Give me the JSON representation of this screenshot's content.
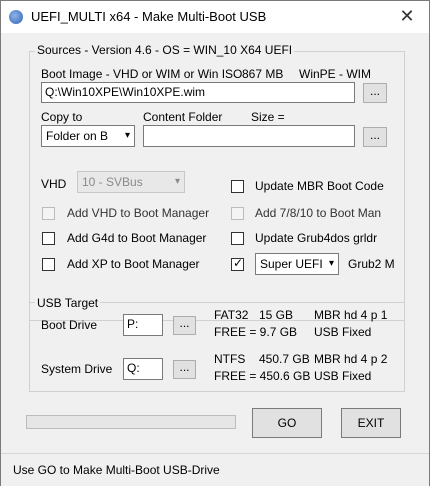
{
  "window": {
    "title": "UEFI_MULTI x64 - Make Multi-Boot USB",
    "close_glyph": "✕"
  },
  "sources": {
    "legend": "Sources  - Version 4.6  -  OS = WIN_10 X64  UEFI",
    "boot_image_label": "Boot Image - VHD or WIM or Win ISO",
    "boot_image_size": "867 MB",
    "boot_image_type": "WinPE - WIM",
    "boot_image_path": "Q:\\Win10XPE\\Win10XPE.wim",
    "browse_label": "...",
    "copy_to_label": "Copy to",
    "copy_to_value": "Folder on B",
    "content_folder_label": "Content Folder",
    "size_label": "Size  =",
    "content_folder_value": "",
    "vhd_label": "VHD",
    "vhd_value": "10 - SVBus",
    "options": {
      "add_vhd": "Add VHD to Boot Manager",
      "add_g4d": "Add G4d to Boot Manager",
      "add_xp": "Add XP to Boot Manager",
      "update_mbr": "Update MBR Boot Code",
      "add_7810": "Add 7/8/10 to Boot Man",
      "update_grub4dos": "Update Grub4dos grldr",
      "super_uefi": "Super UEFI",
      "grub2": "Grub2 M"
    }
  },
  "usb_target": {
    "legend": "USB Target",
    "boot_drive_label": "Boot  Drive",
    "boot_drive_value": "P:",
    "boot_fs": "FAT32",
    "boot_total": "15 GB",
    "boot_free": "FREE = 9.7 GB",
    "boot_mbr": "MBR  hd 4  p 1",
    "boot_usb": "USB   Fixed",
    "system_drive_label": "System Drive",
    "system_drive_value": "Q:",
    "system_fs": "NTFS",
    "system_total": "450.7 GB",
    "system_free": "FREE = 450.6 GB",
    "system_mbr": "MBR  hd 4  p 2",
    "system_usb": "USB   Fixed",
    "browse_label": "..."
  },
  "actions": {
    "go_label": "GO",
    "exit_label": "EXIT",
    "progress": 0
  },
  "status": {
    "text": "Use GO to Make Multi-Boot USB-Drive"
  },
  "colors": {
    "progress_fill": "#06b025",
    "window_bg": "#f0f0f0"
  }
}
